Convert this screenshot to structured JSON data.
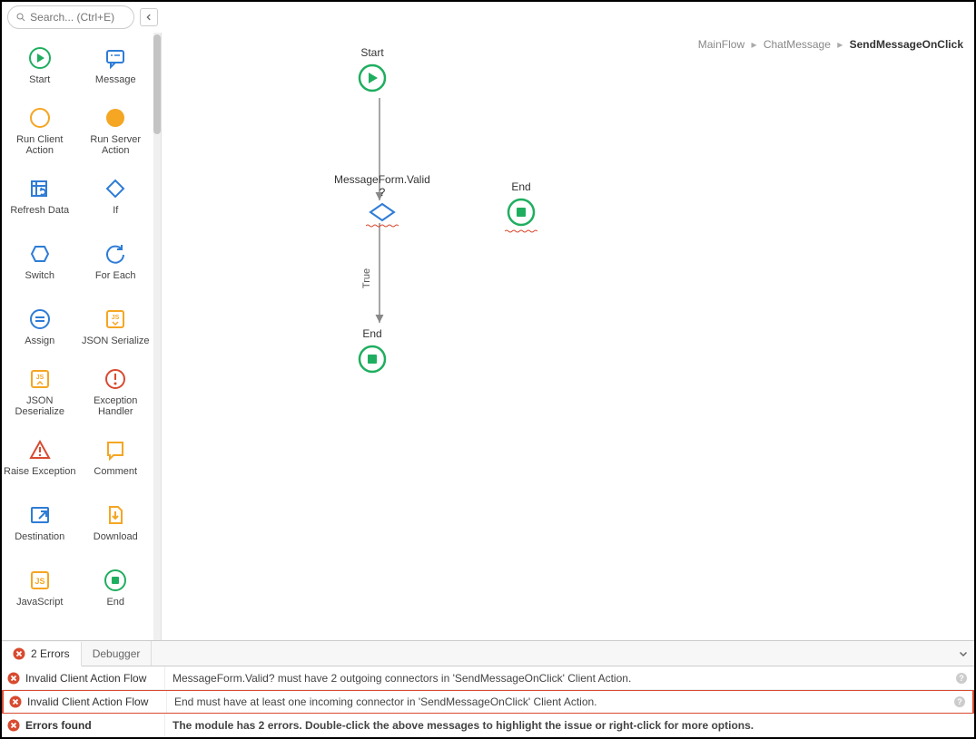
{
  "search": {
    "placeholder": "Search... (Ctrl+E)"
  },
  "breadcrumb": {
    "a": "MainFlow",
    "b": "ChatMessage",
    "c": "SendMessageOnClick"
  },
  "toolbox": {
    "items": [
      {
        "label": "Start"
      },
      {
        "label": "Message"
      },
      {
        "label": "Run Client Action"
      },
      {
        "label": "Run Server Action"
      },
      {
        "label": "Refresh Data"
      },
      {
        "label": "If"
      },
      {
        "label": "Switch"
      },
      {
        "label": "For Each"
      },
      {
        "label": "Assign"
      },
      {
        "label": "JSON Serialize"
      },
      {
        "label": "JSON Deserialize"
      },
      {
        "label": "Exception Handler"
      },
      {
        "label": "Raise Exception"
      },
      {
        "label": "Comment"
      },
      {
        "label": "Destination"
      },
      {
        "label": "Download"
      },
      {
        "label": "JavaScript"
      },
      {
        "label": "End"
      }
    ]
  },
  "flow": {
    "start": {
      "label": "Start"
    },
    "if": {
      "label": "MessageForm.Valid\n?"
    },
    "edge_true": "True",
    "end1": {
      "label": "End"
    },
    "end2": {
      "label": "End"
    }
  },
  "tabs": {
    "errors": "2 Errors",
    "debugger": "Debugger"
  },
  "errors": {
    "rows": [
      {
        "title": "Invalid Client Action Flow",
        "msg": "MessageForm.Valid? must have 2 outgoing connectors in 'SendMessageOnClick' Client Action."
      },
      {
        "title": "Invalid Client Action Flow",
        "msg": "End must have at least one incoming connector in 'SendMessageOnClick' Client Action."
      },
      {
        "title": "Errors found",
        "msg": "The module has 2 errors. Double-click the above messages to highlight the issue or right-click for more options."
      }
    ]
  }
}
